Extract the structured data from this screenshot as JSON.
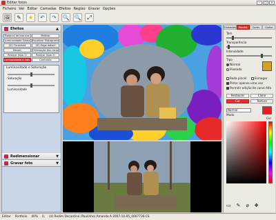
{
  "title": "Editar fotos",
  "menu": [
    "Ficheiro",
    "Ver",
    "Editar",
    "Camadas",
    "Efeitos",
    "Região",
    "Gravar",
    "Opções"
  ],
  "left": {
    "section": "Efeitos",
    "buttons": [
      "Balanco de brancos",
      "Matizar",
      "Luminosidade Gama",
      "Equalizar Histograma",
      "(Sí) Threshold",
      "(Sí) Edge detect",
      "Mosaic",
      "Ordenação dos canais RGB",
      "Realçar (tipo 1)",
      "Realçar (tipo 2)",
      "Luminosidade e Saturação",
      "Contraste"
    ],
    "selected": "Luminosidade e Saturação",
    "panel_title": "Luminosidade e Saturação",
    "panel_labels": [
      "Saturação",
      "Luminosidade"
    ],
    "sections": [
      "Redimensionar",
      "Gravar foto"
    ]
  },
  "right": {
    "tabs": [
      "Camadas",
      "Pincéis",
      "Cores",
      "Cortar"
    ],
    "active_tab": "Pincéis",
    "labels": [
      "Tam",
      "Transparência",
      "Intensidade",
      "Tipo"
    ],
    "types": [
      "Normal",
      "Pixelado"
    ],
    "checks": [
      "Roda pincel",
      "Esmagar",
      "Pintar apenas uma vez",
      "Permitir edição de canal Alfa"
    ],
    "buttons": [
      "Restaurar",
      "Clone"
    ],
    "subtabs": [
      "Cor",
      "Textura"
    ],
    "mode_select": "Normal",
    "mode_label": "Modo",
    "cor_label": "Cor",
    "active_color": "#ee1c24"
  },
  "status": [
    "Editar",
    "Portfolio",
    "40%",
    "0,",
    "(d) Redim Decantine (Paulinho) Amanda A 2007-10-05_0007736.CS"
  ]
}
